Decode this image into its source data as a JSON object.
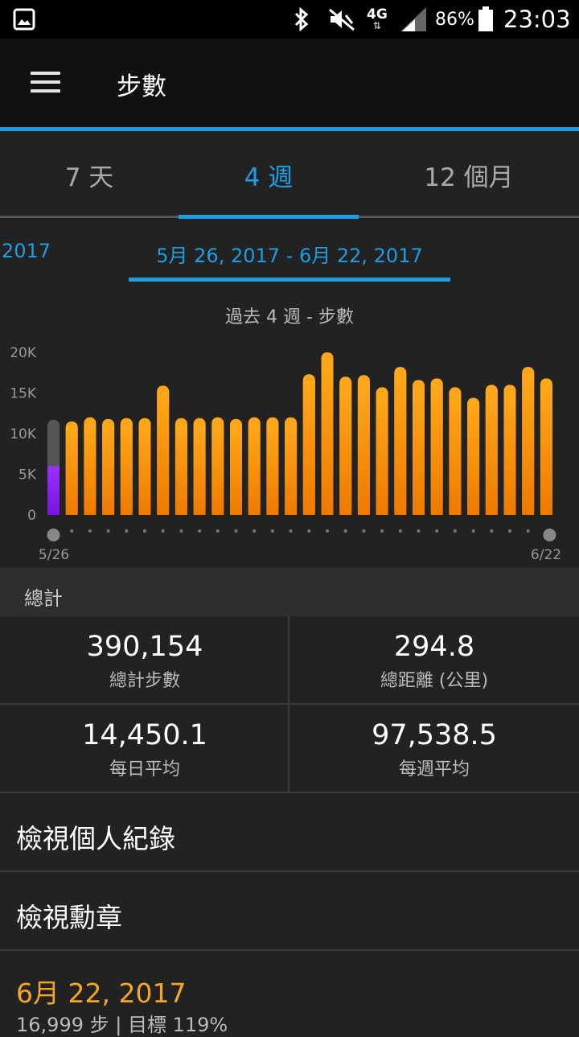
{
  "status_bar": {
    "network": "4G",
    "battery": "86%",
    "time": "23:03"
  },
  "app_bar": {
    "title": "步數"
  },
  "tabs": [
    {
      "label": "7 天",
      "active": false
    },
    {
      "label": "4 週",
      "active": true
    },
    {
      "label": "12 個月",
      "active": false
    }
  ],
  "date_nav": {
    "previous": "2017",
    "current": "5月 26, 2017 - 6月 22, 2017"
  },
  "chart_data": {
    "type": "bar",
    "title": "過去 4 週 - 步數",
    "y_ticks": [
      "20K",
      "15K",
      "10K",
      "5K",
      "0"
    ],
    "ylim": [
      0,
      20000
    ],
    "x_start_label": "5/26",
    "x_end_label": "6/22",
    "values": [
      11500,
      12000,
      11800,
      11900,
      11900,
      15900,
      11900,
      11900,
      12000,
      11800,
      12000,
      12000,
      12000,
      17300,
      20000,
      17000,
      17200,
      15700,
      18200,
      16600,
      16800,
      15700,
      14400,
      16000,
      16000,
      18200,
      16800
    ],
    "today": {
      "goal": 11700,
      "current": 6000
    },
    "bar_color": "#ff9f12",
    "today_color": "#9b30ff"
  },
  "totals": {
    "header": "總計",
    "total_steps": {
      "value": "390,154",
      "label": "總計步數"
    },
    "total_distance": {
      "value": "294.8",
      "label": "總距離 (公里)"
    },
    "daily_average": {
      "value": "14,450.1",
      "label": "每日平均"
    },
    "weekly_average": {
      "value": "97,538.5",
      "label": "每週平均"
    }
  },
  "list": {
    "records": "檢視個人紀錄",
    "badges": "檢視勳章"
  },
  "day_entry": {
    "date": "6月 22, 2017",
    "summary": "16,999 步 | 目標 119%"
  }
}
